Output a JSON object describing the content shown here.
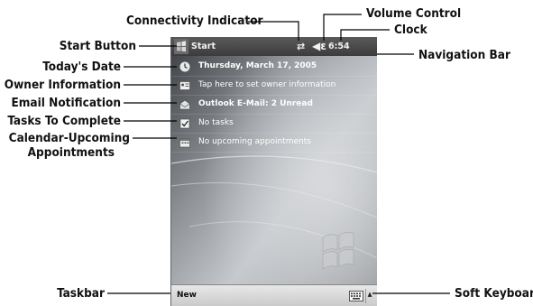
{
  "labels": {
    "connectivity_indicator": "Connectivity Indicator",
    "volume_control": "Volume Control",
    "clock": "Clock",
    "start_button": "Start Button",
    "navigation_bar": "Navigation Bar",
    "todays_date": "Today's Date",
    "owner_information": "Owner Information",
    "email_notification": "Email Notification",
    "tasks_to_complete": "Tasks To Complete",
    "calendar_line1": "Calendar-Upcoming",
    "calendar_line2": "Appointments",
    "taskbar": "Taskbar",
    "soft_keyboard": "Soft Keyboard"
  },
  "screen": {
    "navbar": {
      "start": "Start",
      "time": "6:54"
    },
    "today": {
      "date": "Thursday, March 17, 2005",
      "owner": "Tap here to set owner information",
      "email": "Outlook E-Mail: 2 Unread",
      "tasks": "No tasks",
      "calendar": "No upcoming appointments"
    },
    "taskbar": {
      "new_label": "New"
    }
  },
  "icons": {
    "start": "windows-flag-icon",
    "connectivity": "connectivity-arrows-icon",
    "volume": "speaker-icon",
    "date": "clock-face-icon",
    "owner": "contact-card-icon",
    "email": "envelope-icon",
    "tasks": "checkbox-icon",
    "calendar": "calendar-icon",
    "keyboard": "keyboard-icon"
  },
  "colors": {
    "wallpaper_light": "#b9bcc0",
    "wallpaper_dark": "#2f3236",
    "navbar": "#3f3f3f",
    "taskbar": "#d6d6d6"
  }
}
